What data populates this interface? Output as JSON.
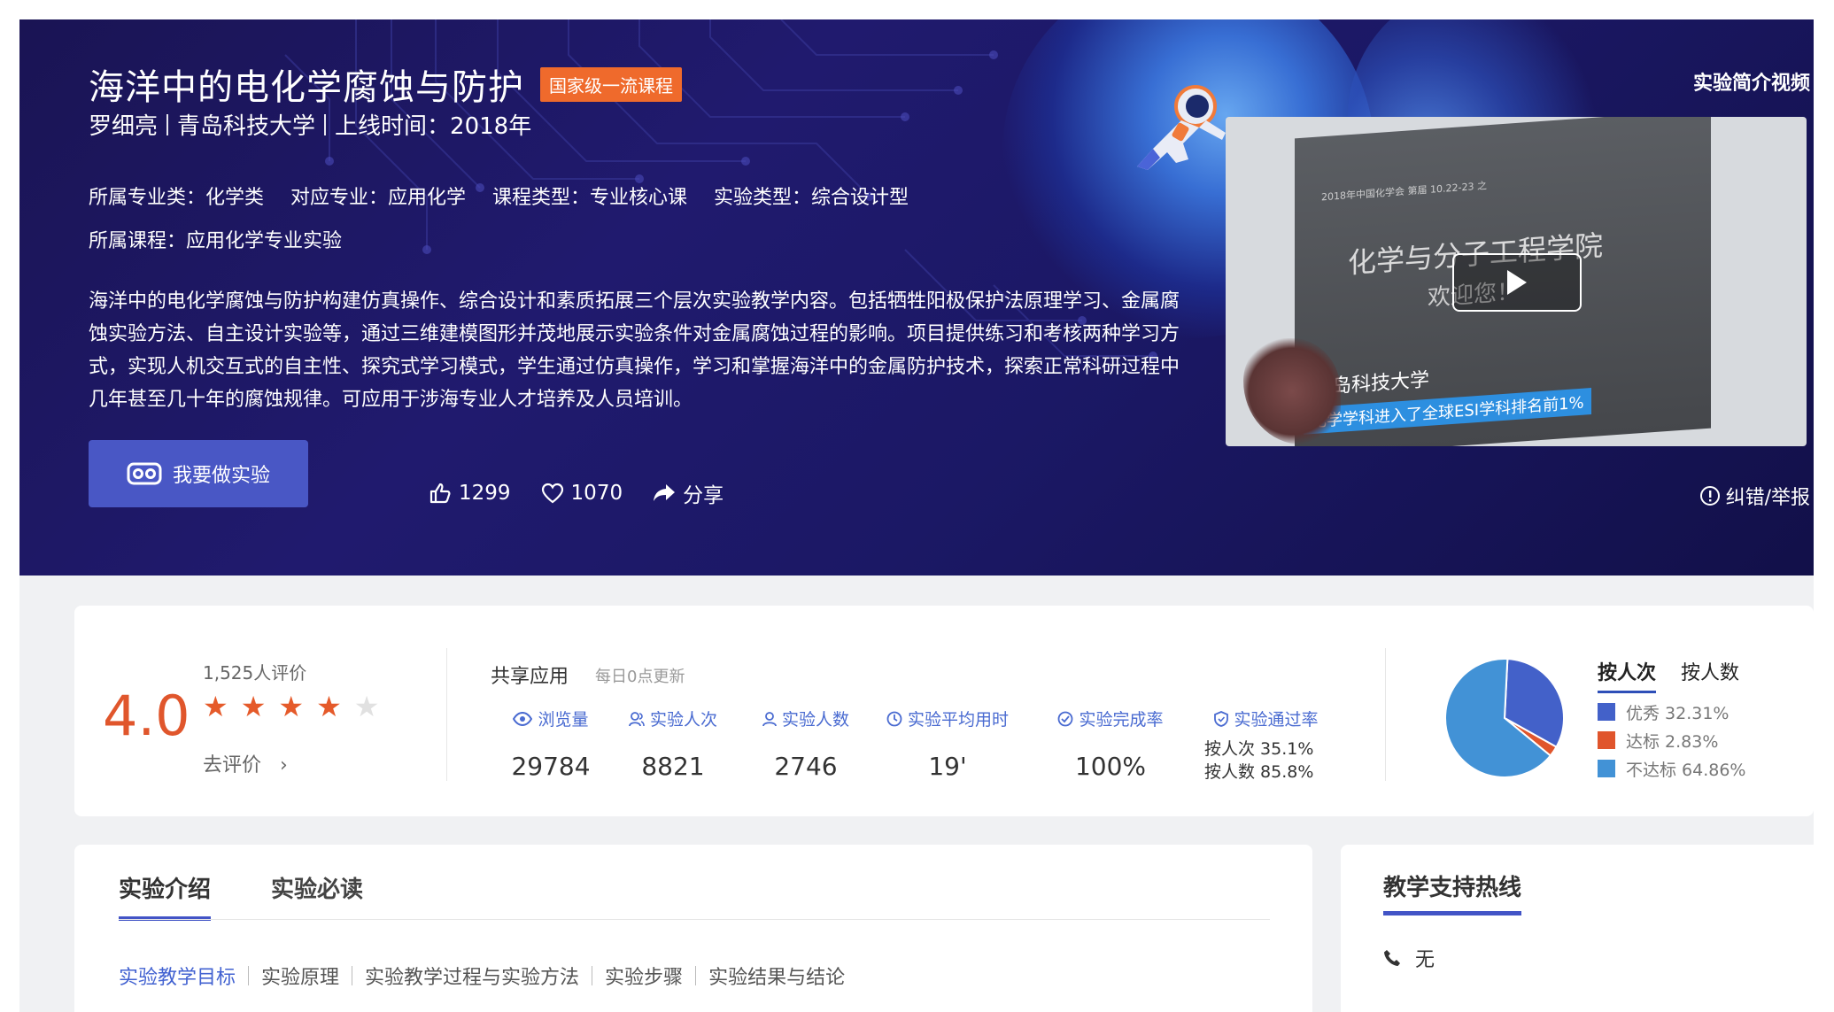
{
  "hero": {
    "title": "海洋中的电化学腐蚀与防护",
    "badge": "国家级一流课程",
    "teacher": "罗细亮",
    "university": "青岛科技大学",
    "online": "上线时间：2018年",
    "major_category": "所属专业类：化学类",
    "major": "对应专业：应用化学",
    "course_type": "课程类型：专业核心课",
    "exp_type": "实验类型：综合设计型",
    "course": "所属课程：应用化学专业实验",
    "description": "海洋中的电化学腐蚀与防护构建仿真操作、综合设计和素质拓展三个层次实验教学内容。包括牺牲阳极保护法原理学习、金属腐蚀实验方法、自主设计实验等，通过三维建模图形并茂地展示实验条件对金属腐蚀过程的影响。项目提供练习和考核两种学习方式，实现人机交互式的自主性、探究式学习模式，学生通过仿真操作，学习和掌握海洋中的金属防护技术，探索正常科研过程中几年甚至几十年的腐蚀规律。可应用于涉海专业人才培养及人员培训。",
    "do_experiment": "我要做实验",
    "likes": "1299",
    "favorites": "1070",
    "share": "分享",
    "video_title": "实验简介视频",
    "report": "纠错/举报",
    "video_screen": {
      "line": "2018年中国化学会 第届 10.22-23 之",
      "big1": "化学与分子工程学院",
      "big2": "欢迎您！",
      "univ": "青岛科技大学",
      "banner": "化学学科进入了全球ESI学科排名前1%"
    }
  },
  "rating": {
    "score": "4.0",
    "count": "1,525人评价",
    "stars_filled": 4,
    "stars_total": 5,
    "go_rate": "去评价"
  },
  "share": {
    "title": "共享应用",
    "subtitle": "每日0点更新",
    "stats": [
      {
        "label": "浏览量",
        "value": "29784"
      },
      {
        "label": "实验人次",
        "value": "8821"
      },
      {
        "label": "实验人数",
        "value": "2746"
      },
      {
        "label": "实验平均用时",
        "value": "19'"
      },
      {
        "label": "实验完成率",
        "value": "100%"
      },
      {
        "label": "实验通过率",
        "line1": "按人次 35.1%",
        "line2": "按人数 85.8%"
      }
    ]
  },
  "pie": {
    "tabs": [
      "按人次",
      "按人数"
    ],
    "legend": [
      {
        "label": "优秀 32.31%",
        "color": "#4361c9"
      },
      {
        "label": "达标 2.83%",
        "color": "#e0552c"
      },
      {
        "label": "不达标 64.86%",
        "color": "#4292d6"
      }
    ]
  },
  "chart_data": {
    "type": "pie",
    "categories": [
      "优秀",
      "达标",
      "不达标"
    ],
    "values": [
      32.31,
      2.83,
      64.86
    ],
    "colors": [
      "#4361c9",
      "#e0552c",
      "#4292d6"
    ]
  },
  "intro": {
    "tabs": [
      "实验介绍",
      "实验必读"
    ],
    "subnav": [
      "实验教学目标",
      "实验原理",
      "实验教学过程与实验方法",
      "实验步骤",
      "实验结果与结论"
    ]
  },
  "support": {
    "title": "教学支持热线",
    "value": "无"
  }
}
